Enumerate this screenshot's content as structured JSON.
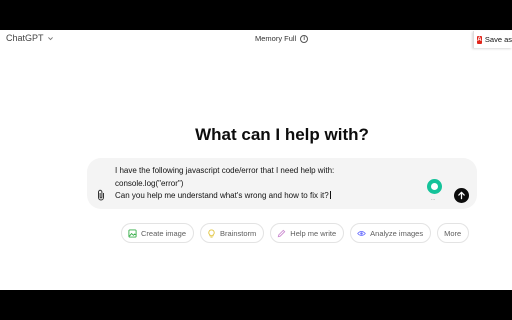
{
  "header": {
    "model_label": "ChatGPT",
    "memory_label": "Memory Full",
    "memory_info_icon": "info-icon",
    "save_as_label": "Save as"
  },
  "main": {
    "heading": "What can I help with?"
  },
  "composer": {
    "lines": [
      "I have the following javascript code/error that I need help with:",
      "console.log(\"error\")",
      "Can you help me understand what's wrong and how to fix it?"
    ],
    "grammarly_dots": "...",
    "icons": {
      "attach": "paperclip-icon",
      "send": "arrow-up-icon",
      "grammarly": "grammarly-icon"
    }
  },
  "suggestions": [
    {
      "label": "Create image",
      "icon": "image-icon",
      "color": "#35ae47"
    },
    {
      "label": "Brainstorm",
      "icon": "lightbulb-icon",
      "color": "#e2c541"
    },
    {
      "label": "Help me write",
      "icon": "pen-icon",
      "color": "#cb8bd0"
    },
    {
      "label": "Analyze images",
      "icon": "eye-icon",
      "color": "#6c71ff"
    },
    {
      "label": "More",
      "icon": "",
      "color": ""
    }
  ],
  "colors": {
    "composer_bg": "#f4f4f4",
    "send_button": "#0d0d0d",
    "pdf_red": "#e1251b",
    "grammarly_green": "#15c39a"
  }
}
